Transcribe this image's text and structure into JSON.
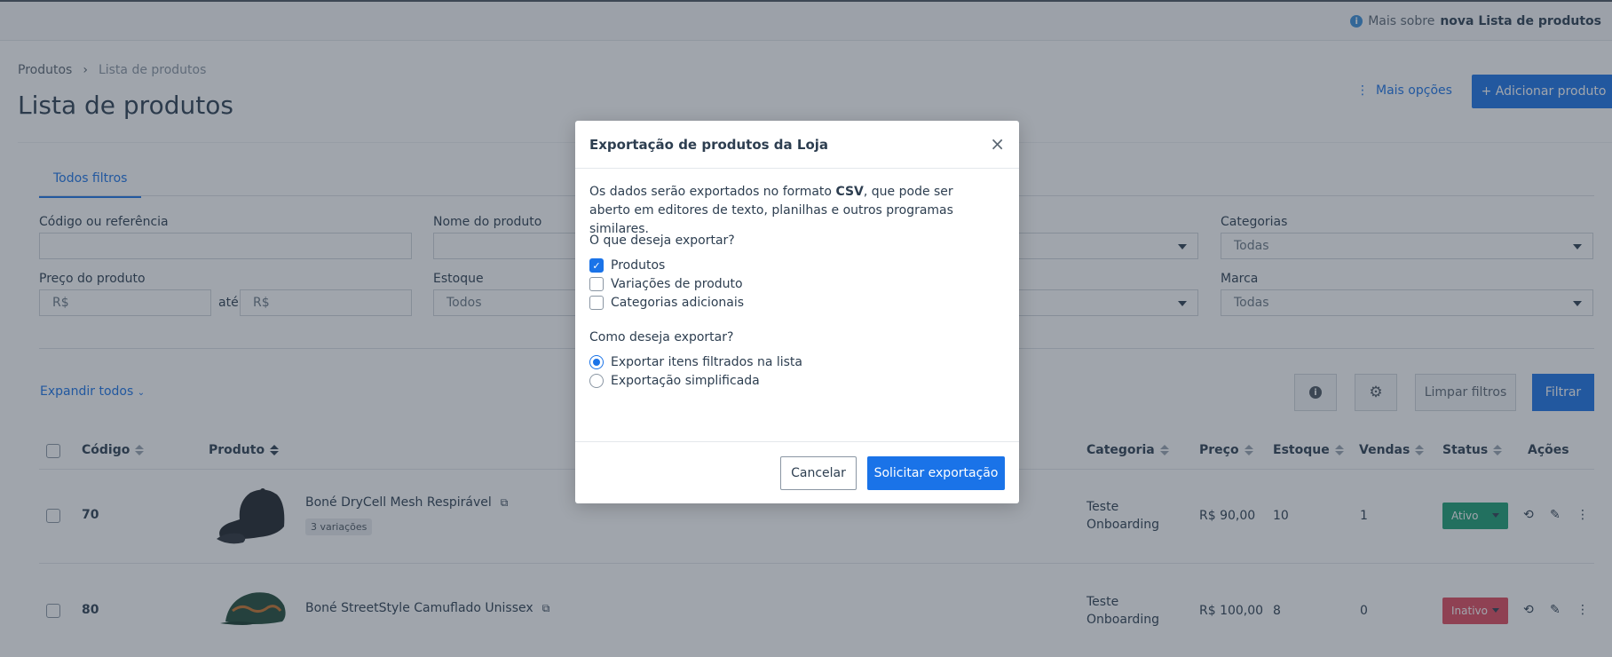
{
  "topbar": {
    "info_prefix": "Mais sobre",
    "info_bold": "nova Lista de produtos"
  },
  "breadcrumb": {
    "root": "Produtos",
    "sep": "›",
    "current": "Lista de produtos"
  },
  "page": {
    "title": "Lista de produtos",
    "more_options": "Mais opções",
    "add_product": "+ Adicionar produto"
  },
  "filters": {
    "tab": "Todos filtros",
    "code_label": "Código ou referência",
    "name_label": "Nome do produto",
    "categories_label": "Categorias",
    "categories_value": "Todas",
    "price_label": "Preço do produto",
    "price_from": "R$",
    "price_sep": "até",
    "price_to": "R$",
    "stock_label": "Estoque",
    "stock_value": "Todos",
    "brand_label": "Marca",
    "brand_value": "Todas",
    "expand_all": "Expandir todos",
    "clear": "Limpar filtros",
    "filter": "Filtrar"
  },
  "table": {
    "headers": {
      "code": "Código",
      "product": "Produto",
      "category": "Categoria",
      "price": "Preço",
      "stock": "Estoque",
      "sales": "Vendas",
      "status": "Status",
      "actions": "Ações"
    },
    "rows": [
      {
        "code": "70",
        "name": "Boné DryCell Mesh Respirável",
        "variations": "3 variações",
        "category": "Teste Onboarding",
        "price": "R$ 90,00",
        "stock": "10",
        "sales": "1",
        "status": "Ativo",
        "status_color": "#1a9e73"
      },
      {
        "code": "80",
        "name": "Boné StreetStyle Camuflado Unissex",
        "category": "Teste Onboarding",
        "price": "R$ 100,00",
        "stock": "8",
        "sales": "0",
        "status": "Inativo",
        "status_color": "#e0495e"
      }
    ]
  },
  "modal": {
    "title": "Exportação de produtos da Loja",
    "close": "×",
    "desc_1": "Os dados serão exportados no formato ",
    "desc_bold": "CSV",
    "desc_2": ", que pode ser aberto em editores de texto, planilhas e outros programas similares.",
    "q1": "O que deseja exportar?",
    "opt_products": "Produtos",
    "opt_variations": "Variações de produto",
    "opt_categories": "Categorias adicionais",
    "q2": "Como deseja exportar?",
    "radio_filtered": "Exportar itens filtrados na lista",
    "radio_simple": "Exportação simplificada",
    "cancel": "Cancelar",
    "submit": "Solicitar exportação"
  },
  "colors": {
    "accent": "#1a73e8",
    "active": "#1a9e73",
    "inactive": "#e0495e"
  }
}
